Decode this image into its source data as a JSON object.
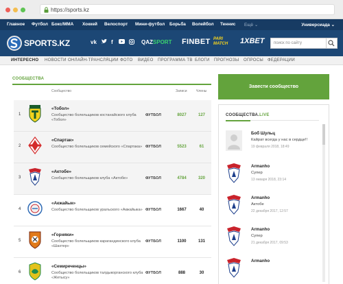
{
  "browser": {
    "url": "https://sports.kz",
    "dots": [
      "close",
      "minimize",
      "maximize"
    ]
  },
  "topnav": {
    "items": [
      "Главное",
      "Футбол",
      "Бокс/ММА",
      "Хоккей",
      "Велоспорт",
      "Мини-футбол",
      "Борьба",
      "Волейбол",
      "Теннис"
    ],
    "more": "Ещё ⌄",
    "university": "Универсиада ⌄"
  },
  "logo": {
    "text": "SPORTS.KZ"
  },
  "social_icons": [
    "vk-icon",
    "twitter-icon",
    "facebook-icon",
    "youtube-icon",
    "instagram-icon"
  ],
  "partners": {
    "qazsport_a": "QAZ",
    "qazsport_b": "SPORT",
    "finbet": "FINBET",
    "parimatch": "PARI MATCH",
    "onexbet": "1XBET"
  },
  "search": {
    "placeholder": "поиск по сайту"
  },
  "subnav": [
    "ИНТЕРЕСНО",
    "НОВОСТИ",
    "ОНЛАЙН-ТРАНСЛЯЦИИ",
    "ФОТО",
    "ВИДЕО",
    "ПРОГРАММА ТВ",
    "БЛОГИ",
    "ПРОГНОЗЫ",
    "ОПРОСЫ",
    "ФЕДЕРАЦИИ"
  ],
  "communities": {
    "title": "СООБЩЕСТВА",
    "headers": {
      "community": "Сообщество",
      "posts": "Записи",
      "members": "Члены"
    },
    "rows": [
      {
        "rank": "1",
        "name": "«Тобол»",
        "desc": "Сообщество болельщиков костанайского клуба «Тобол»",
        "category": "ФУТБОЛ",
        "posts": "8027",
        "members": "127",
        "crest": "tobol-crest-icon",
        "crest_color": "#f2d21e"
      },
      {
        "rank": "2",
        "name": "«Спартак»",
        "desc": "Сообщество болельщиков семейского «Спартака»",
        "category": "ФУТБОЛ",
        "posts": "5523",
        "members": "61",
        "crest": "spartak-crest-icon",
        "crest_color": "#d42b2b"
      },
      {
        "rank": "3",
        "name": "«Актобе»",
        "desc": "Сообщество болельщиков клуба «Актобе»",
        "category": "ФУТБОЛ",
        "posts": "4784",
        "members": "320",
        "crest": "aktobe-crest-icon",
        "crest_color": "#c9232c"
      },
      {
        "rank": "4",
        "name": "«Акжайык»",
        "desc": "Сообщество болельщиков уральского «Акжайыка»",
        "category": "ФУТБОЛ",
        "posts": "1667",
        "members": "40",
        "crest": "akzhaiyk-crest-icon",
        "crest_color": "#2f6bb5"
      },
      {
        "rank": "5",
        "name": "«Горняки»",
        "desc": "Сообщество болельщиков карагандинского клуба «Шахтер»",
        "category": "ФУТБОЛ",
        "posts": "1100",
        "members": "131",
        "crest": "shakhter-crest-icon",
        "crest_color": "#e07a1a"
      },
      {
        "rank": "6",
        "name": "«Семиреченцы»",
        "desc": "Сообщество болельщиков талдыкорганского клуба «Жетысу»",
        "category": "ФУТБОЛ",
        "posts": "888",
        "members": "30",
        "crest": "zhetysu-crest-icon",
        "crest_color": "#e3c21c"
      }
    ]
  },
  "create_button": "Завести сообщество",
  "live": {
    "title_a": "СООБЩЕСТВА.",
    "title_b": "LIVE",
    "entries": [
      {
        "user": "Боб Шульц",
        "text": "Кайрат всегда у нас в сердце!!",
        "time": "19 февраля 2018, 18:49",
        "avatar": "default-avatar-icon"
      },
      {
        "user": "Armanho",
        "text": "Супер",
        "time": "13 января 2018, 23:14",
        "avatar": "aktobe-avatar-icon"
      },
      {
        "user": "Armanho",
        "text": "Актобе",
        "time": "22 декабря 2017, 12:57",
        "avatar": "aktobe-avatar-icon"
      },
      {
        "user": "Armanho",
        "text": "Супер",
        "time": "21 декабря 2017, 09:53",
        "avatar": "aktobe-avatar-icon"
      },
      {
        "user": "Armanho",
        "text": "",
        "time": "",
        "avatar": "aktobe-avatar-icon"
      }
    ]
  },
  "colors": {
    "accent": "#63a33c",
    "navy": "#173b63",
    "logobar": "#1c4775"
  }
}
